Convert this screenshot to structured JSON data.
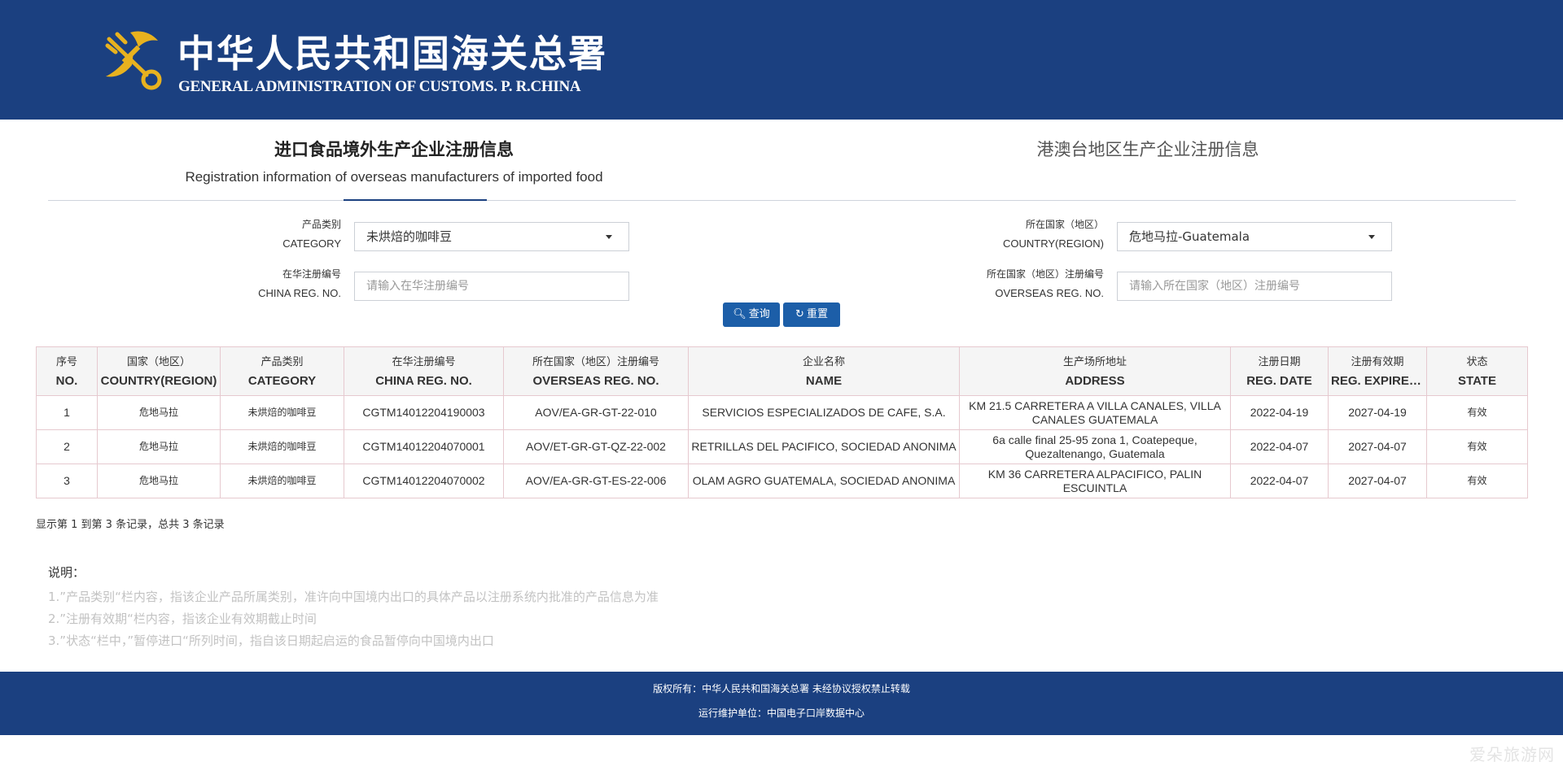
{
  "header": {
    "title_cn": "中华人民共和国海关总署",
    "title_en": "GENERAL ADMINISTRATION OF CUSTOMS. P. R.CHINA",
    "emblem_icon": "customs-emblem-icon"
  },
  "tabs": {
    "active_cn": "进口食品境外生产企业注册信息",
    "active_en": "Registration information of overseas manufacturers of imported food",
    "other_cn": "港澳台地区生产企业注册信息"
  },
  "form": {
    "category_label_cn": "产品类别",
    "category_label_en": "CATEGORY",
    "category_value": "未烘焙的咖啡豆",
    "country_label_cn": "所在国家（地区）",
    "country_label_en": "COUNTRY(REGION)",
    "country_value": "危地马拉-Guatemala",
    "china_reg_label_cn": "在华注册编号",
    "china_reg_label_en": "CHINA REG. NO.",
    "china_reg_placeholder": "请输入在华注册编号",
    "overseas_reg_label_cn": "所在国家（地区）注册编号",
    "overseas_reg_label_en": "OVERSEAS REG. NO.",
    "overseas_reg_placeholder": "请输入所在国家（地区）注册编号",
    "search_button": "查询",
    "reset_button": "重置"
  },
  "table": {
    "headers": [
      {
        "cn": "序号",
        "en": "NO."
      },
      {
        "cn": "国家（地区）",
        "en": "COUNTRY(REGION)"
      },
      {
        "cn": "产品类别",
        "en": "CATEGORY"
      },
      {
        "cn": "在华注册编号",
        "en": "CHINA REG. NO."
      },
      {
        "cn": "所在国家（地区）注册编号",
        "en": "OVERSEAS REG. NO."
      },
      {
        "cn": "企业名称",
        "en": "NAME"
      },
      {
        "cn": "生产场所地址",
        "en": "ADDRESS"
      },
      {
        "cn": "注册日期",
        "en": "REG. DATE"
      },
      {
        "cn": "注册有效期",
        "en": "REG. EXPIRE D..."
      },
      {
        "cn": "状态",
        "en": "STATE"
      }
    ],
    "rows": [
      [
        "1",
        "危地马拉",
        "未烘焙的咖啡豆",
        "CGTM14012204190003",
        "AOV/EA-GR-GT-22-010",
        "SERVICIOS ESPECIALIZADOS DE CAFE, S.A.",
        "KM 21.5 CARRETERA A VILLA CANALES, VILLA CANALES GUATEMALA",
        "2022-04-19",
        "2027-04-19",
        "有效"
      ],
      [
        "2",
        "危地马拉",
        "未烘焙的咖啡豆",
        "CGTM14012204070001",
        "AOV/ET-GR-GT-QZ-22-002",
        "RETRILLAS DEL PACIFICO, SOCIEDAD ANONIMA",
        "6a calle final 25-95 zona 1, Coatepeque, Quezaltenango, Guatemala",
        "2022-04-07",
        "2027-04-07",
        "有效"
      ],
      [
        "3",
        "危地马拉",
        "未烘焙的咖啡豆",
        "CGTM14012204070002",
        "AOV/EA-GR-GT-ES-22-006",
        "OLAM AGRO GUATEMALA, SOCIEDAD ANONIMA",
        "KM 36 CARRETERA ALPACIFICO, PALIN ESCUINTLA",
        "2022-04-07",
        "2027-04-07",
        "有效"
      ]
    ]
  },
  "summary": "显示第 1 到第 3 条记录，总共 3 条记录",
  "notes": {
    "title": "说明：",
    "items": [
      "1.”产品类别“栏内容，指该企业产品所属类别，准许向中国境内出口的具体产品以注册系统内批准的产品信息为准",
      "2.”注册有效期“栏内容，指该企业有效期截止时间",
      "3.”状态“栏中，”暂停进口“所列时间，指自该日期起启运的食品暂停向中国境内出口"
    ]
  },
  "footer": {
    "copyright": "版权所有：中华人民共和国海关总署 未经协议授权禁止转载",
    "maintainer": "运行维护单位：中国电子口岸数据中心"
  },
  "watermark": "爱朵旅游网",
  "colors": {
    "header_bg": "#1b4080",
    "button_bg": "#1c5ea8",
    "emblem_gold": "#e8b21f"
  }
}
